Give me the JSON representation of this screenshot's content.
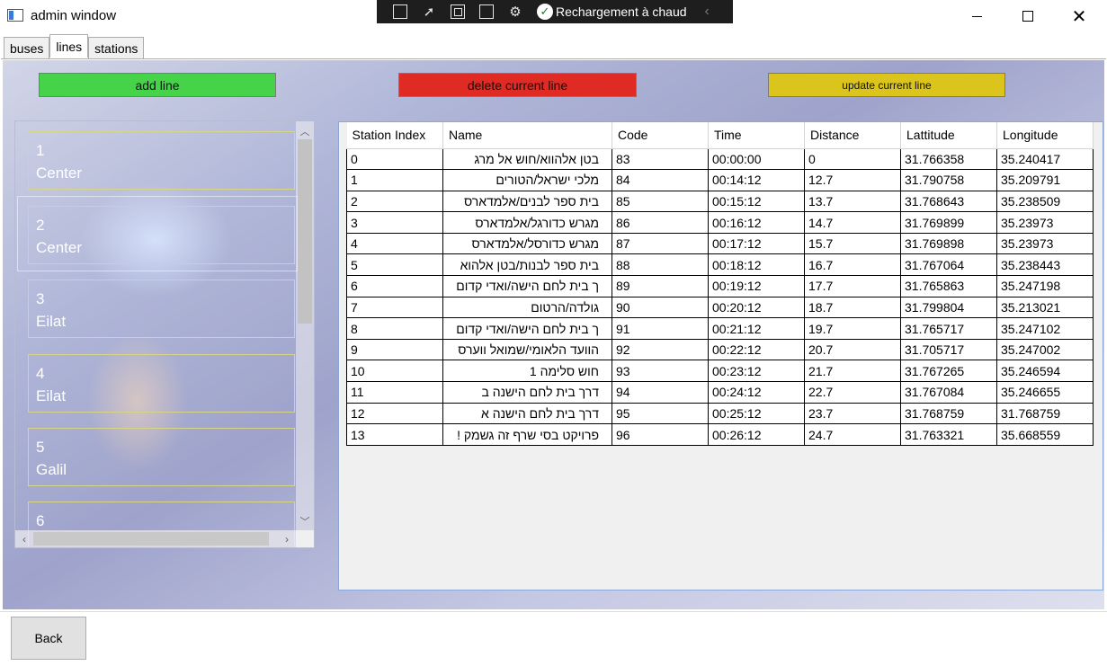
{
  "window": {
    "title": "admin window",
    "close_glyph": "✕"
  },
  "debug_toolbar": {
    "hot_reload_label": "Rechargement à chaud",
    "collapse_glyph": "‹"
  },
  "tabs": [
    {
      "label": "buses",
      "active": false
    },
    {
      "label": "lines",
      "active": true
    },
    {
      "label": "stations",
      "active": false
    }
  ],
  "actions": {
    "add_label": "add line",
    "delete_label": "delete current line",
    "update_label": "update current line",
    "add_color": "#46d34a",
    "delete_color": "#e02a24",
    "update_color": "#dbc41c"
  },
  "lines_list": {
    "items": [
      {
        "number": "1",
        "area": "Center"
      },
      {
        "number": "2",
        "area": "Center"
      },
      {
        "number": "3",
        "area": "Eilat"
      },
      {
        "number": "4",
        "area": "Eilat"
      },
      {
        "number": "5",
        "area": "Galil"
      },
      {
        "number": "6",
        "area": ""
      }
    ],
    "selected_index": 1,
    "scroll_up_glyph": "︿",
    "scroll_down_glyph": "﹀",
    "scroll_left_glyph": "‹",
    "scroll_right_glyph": "›"
  },
  "stations_grid": {
    "columns": [
      "Station Index",
      "Name",
      "Code",
      "Time",
      "Distance",
      "Lattitude",
      "Longitude"
    ],
    "rows": [
      [
        "0",
        "בטן אלהווא/חוש אל מרג",
        "83",
        "00:00:00",
        "0",
        "31.766358",
        "35.240417"
      ],
      [
        "1",
        "מלכי ישראל/הטורים",
        "84",
        "00:14:12",
        "12.7",
        "31.790758",
        "35.209791"
      ],
      [
        "2",
        "בית ספר לבנים/אלמדארס",
        "85",
        "00:15:12",
        "13.7",
        "31.768643",
        "35.238509"
      ],
      [
        "3",
        "מגרש כדורגל/אלמדארס",
        "86",
        "00:16:12",
        "14.7",
        "31.769899",
        "35.23973"
      ],
      [
        "4",
        "מגרש כדורסל/אלמדארס",
        "87",
        "00:17:12",
        "15.7",
        "31.769898",
        "35.23973"
      ],
      [
        "5",
        "בית ספר לבנות/בטן אלהוא",
        "88",
        "00:18:12",
        "16.7",
        "31.767064",
        "35.238443"
      ],
      [
        "6",
        "ך בית לחם הישה/ואדי קדום",
        "89",
        "00:19:12",
        "17.7",
        "31.765863",
        "35.247198"
      ],
      [
        "7",
        "גולדה/הרטום",
        "90",
        "00:20:12",
        "18.7",
        "31.799804",
        "35.213021"
      ],
      [
        "8",
        "ך בית לחם הישה/ואדי קדום",
        "91",
        "00:21:12",
        "19.7",
        "31.765717",
        "35.247102"
      ],
      [
        "9",
        "הוועד הלאומי/שמואל ווערס",
        "92",
        "00:22:12",
        "20.7",
        "31.705717",
        "35.247002"
      ],
      [
        "10",
        "חוש סלימה 1",
        "93",
        "00:23:12",
        "21.7",
        "31.767265",
        "35.246594"
      ],
      [
        "11",
        "דרך בית לחם הישנה ב",
        "94",
        "00:24:12",
        "22.7",
        "31.767084",
        "35.246655"
      ],
      [
        "12",
        "דרך בית לחם הישנה א",
        "95",
        "00:25:12",
        "23.7",
        "31.768759",
        "31.768759"
      ],
      [
        "13",
        "פרויקט בסי שרף זה גשמק !",
        "96",
        "00:26:12",
        "24.7",
        "31.763321",
        "35.668559"
      ]
    ]
  },
  "footer": {
    "back_label": "Back"
  }
}
